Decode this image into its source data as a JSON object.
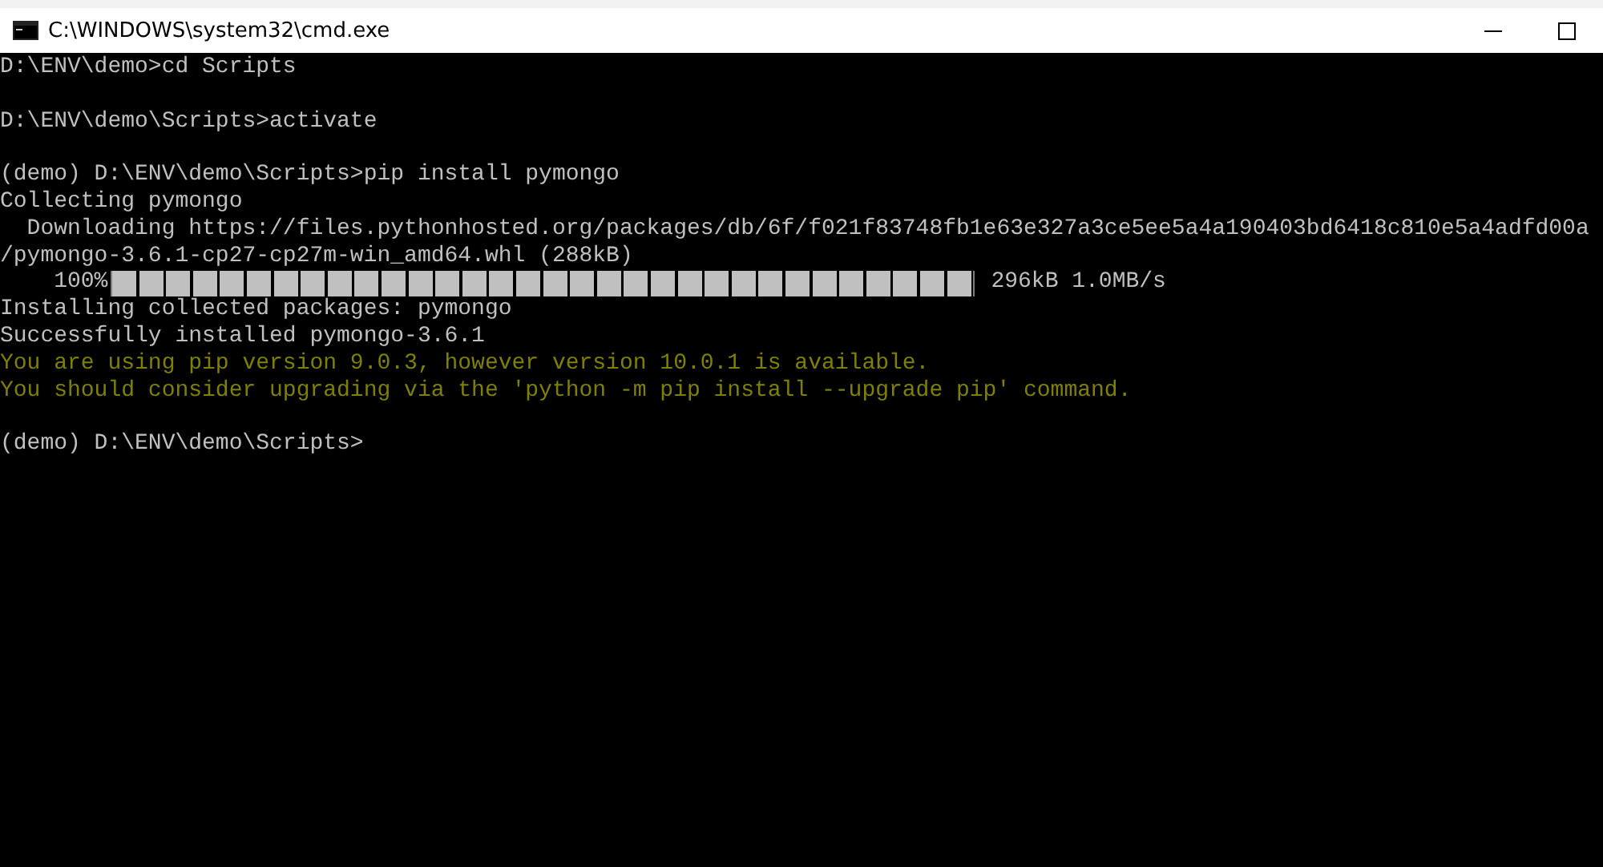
{
  "window": {
    "title": "C:\\WINDOWS\\system32\\cmd.exe"
  },
  "console": {
    "lines": [
      {
        "kind": "text",
        "text": "D:\\ENV\\demo>cd Scripts",
        "color": "#c0c0c0"
      },
      {
        "kind": "blank"
      },
      {
        "kind": "text",
        "text": "D:\\ENV\\demo\\Scripts>activate",
        "color": "#c0c0c0"
      },
      {
        "kind": "blank"
      },
      {
        "kind": "text",
        "text": "(demo) D:\\ENV\\demo\\Scripts>pip install pymongo",
        "color": "#c0c0c0"
      },
      {
        "kind": "text",
        "text": "Collecting pymongo",
        "color": "#c0c0c0"
      },
      {
        "kind": "text",
        "text": "  Downloading https://files.pythonhosted.org/packages/db/6f/f021f83748fb1e63e327a3ce5ee5a4a190403bd6418c810e5a4adfd00a",
        "color": "#c0c0c0"
      },
      {
        "kind": "text",
        "text": "/pymongo-3.6.1-cp27-cp27m-win_amd64.whl (288kB)",
        "color": "#c0c0c0"
      },
      {
        "kind": "progress",
        "percent": "100%",
        "level": 1,
        "reading": "296kB 1.0MB/s",
        "color": "#c0c0c0"
      },
      {
        "kind": "text",
        "text": "Installing collected packages: pymongo",
        "color": "#c0c0c0"
      },
      {
        "kind": "text",
        "text": "Successfully installed pymongo-3.6.1",
        "color": "#c0c0c0"
      },
      {
        "kind": "text",
        "text": "You are using pip version 9.0.3, however version 10.0.1 is available.",
        "color": "#808000"
      },
      {
        "kind": "text",
        "text": "You should consider upgrading via the 'python -m pip install --upgrade pip' command.",
        "color": "#808000"
      },
      {
        "kind": "blank"
      },
      {
        "kind": "text",
        "text": "(demo) D:\\ENV\\demo\\Scripts>",
        "color": "#c0c0c0"
      }
    ]
  }
}
